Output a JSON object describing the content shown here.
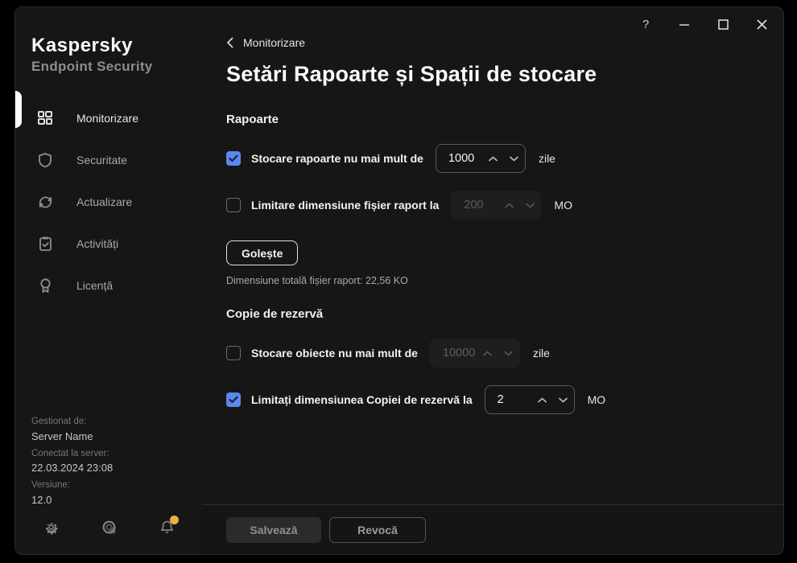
{
  "window_controls": {
    "help": "?",
    "minimize": "—"
  },
  "sidebar": {
    "brand": {
      "name": "Kaspersky",
      "product": "Endpoint Security"
    },
    "items": [
      {
        "label": "Monitorizare",
        "icon": "grid-icon",
        "active": true
      },
      {
        "label": "Securitate",
        "icon": "shield-icon",
        "active": false
      },
      {
        "label": "Actualizare",
        "icon": "refresh-icon",
        "active": false
      },
      {
        "label": "Activități",
        "icon": "clipboard-check-icon",
        "active": false
      },
      {
        "label": "Licență",
        "icon": "badge-icon",
        "active": false
      }
    ],
    "info": {
      "managed_by_label": "Gestionat de:",
      "managed_by_value": "Server Name",
      "connected_label": "Conectat la server:",
      "connected_value": "22.03.2024 23:08",
      "version_label": "Versiune:",
      "version_value": "12.0"
    },
    "tools": [
      {
        "icon": "gear-icon"
      },
      {
        "icon": "support-icon"
      },
      {
        "icon": "bell-icon",
        "notification": true
      }
    ]
  },
  "header": {
    "breadcrumb": "Monitorizare",
    "title": "Setări Rapoarte și Spații de stocare"
  },
  "sections": {
    "reports": {
      "heading": "Rapoarte",
      "rows": [
        {
          "label": "Stocare rapoarte nu mai mult de",
          "value": "1000",
          "unit": "zile",
          "checked": true,
          "enabled": true
        },
        {
          "label": "Limitare dimensiune fișier raport la",
          "value": "200",
          "unit": "MO",
          "checked": false,
          "enabled": false
        }
      ],
      "clear_button": "Golește",
      "total_size": "Dimensiune totală fișier raport: 22,56 KO"
    },
    "backup": {
      "heading": "Copie de rezervă",
      "rows": [
        {
          "label": "Stocare obiecte nu mai mult de",
          "value": "10000",
          "unit": "zile",
          "checked": false,
          "enabled": false
        },
        {
          "label": "Limitați dimensiunea Copiei de rezervă la",
          "value": "2",
          "unit": "MO",
          "checked": true,
          "enabled": true
        }
      ]
    }
  },
  "footer": {
    "save": "Salvează",
    "cancel": "Revocă"
  },
  "colors": {
    "background": "#161617",
    "accent_blue": "#5b87f0",
    "notification_dot": "#eeb043",
    "text_primary": "#fafafa",
    "text_secondary": "#9a9a9a"
  }
}
